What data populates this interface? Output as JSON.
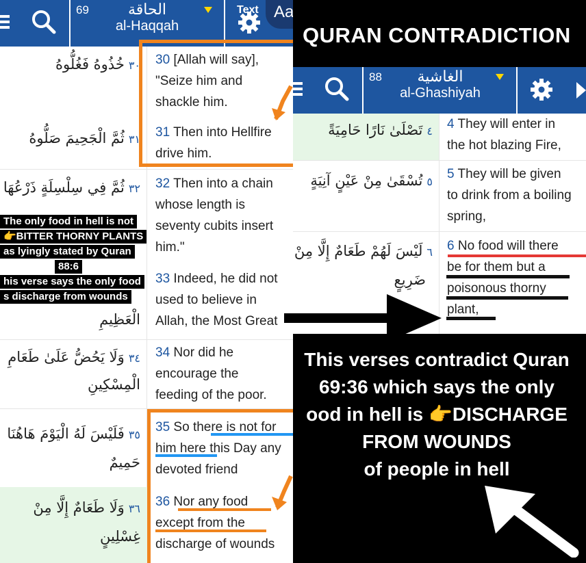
{
  "left": {
    "header": {
      "chapter_number": "69",
      "arabic_title": "الحاقة",
      "latin_title": "al-Haqqah",
      "text_button_label": "Text",
      "font_size_label": "Aa"
    },
    "rows": [
      {
        "arabic": "خُذُوهُ فَغُلُّوهُ",
        "num": "٣٠",
        "en_num": "30",
        "en_text": "[Allah will say],\n\"Seize him and\nshackle him."
      },
      {
        "arabic": "ثُمَّ الْجَحِيمَ صَلُّوهُ",
        "num": "٣١",
        "en_num": "31",
        "en_text": "Then into Hellfire\ndrive him."
      },
      {
        "arabic": "ثُمَّ فِي سِلْسِلَةٍ ذَرْعُهَا",
        "num": "٣٢",
        "en_num": "32",
        "en_text": "Then into a chain\nwhose length is\nseventy cubits insert\nhim.\""
      },
      {
        "arabic": "الْعَظِيمِ",
        "num": "",
        "en_num": "33",
        "en_text": "Indeed, he did not\nused to believe in\nAllah, the Most Great"
      },
      {
        "arabic": "وَلَا يَحُضُّ عَلَىٰ طَعَامِ",
        "arabic2": "الْمِسْكِينِ",
        "num": "٣٤",
        "en_num": "34",
        "en_text": "Nor did he\nencourage the\nfeeding of the poor."
      },
      {
        "arabic": "فَلَيْسَ لَهُ الْيَوْمَ هَاهُنَا",
        "arabic2": "حَمِيمٌ",
        "num": "٣٥",
        "en_num": "35",
        "en_text": "So there is not for\nhim here this Day any\ndevoted friend"
      },
      {
        "arabic": "وَلَا طَعَامٌ إِلَّا مِنْ",
        "arabic2": "غِسْلِينٍ",
        "num": "٣٦",
        "en_num": "36",
        "en_text": "Nor any food\nexcept from the\ndischarge of wounds"
      }
    ],
    "overlay_lines": [
      "The only food in hell is not",
      "👉BITTER THORNY PLANTS",
      "as lyingly stated by Quran",
      "88:6",
      "his verse says the only food",
      "s discharge from wounds"
    ]
  },
  "right": {
    "banner": "QURAN CONTRADICTION",
    "header": {
      "chapter_number": "88",
      "arabic_title": "الغاشية",
      "latin_title": "al-Ghashiyah"
    },
    "rows": [
      {
        "arabic": "تَصْلَىٰ نَارًا حَامِيَةً",
        "num": "٤",
        "en_num": "4",
        "en_text": "They will enter in\nthe hot blazing Fire,"
      },
      {
        "arabic": "تُسْقَىٰ مِنْ عَيْنٍ آنِيَةٍ",
        "num": "٥",
        "en_num": "5",
        "en_text": "They will be given\nto drink from a boiling\nspring,"
      },
      {
        "arabic": "لَيْسَ لَهُمْ طَعَامٌ إِلَّا مِنْ",
        "arabic2": "ضَرِيعٍ",
        "num": "٦",
        "en_num": "6",
        "en_text": "No food will there\nbe for them but a\npoisonous thorny\nplant,"
      }
    ],
    "caption_lines": [
      "This verses contradict Quran",
      "69:36 which says the only",
      "ood in hell is 👉DISCHARGE",
      "FROM WOUNDS",
      "of people in hell"
    ]
  },
  "colors": {
    "header_blue": "#1e56a0",
    "highlight_green": "#e6f6e6",
    "orange": "#f0841e",
    "blue_underline": "#2196f3",
    "red_underline": "#e53935"
  }
}
